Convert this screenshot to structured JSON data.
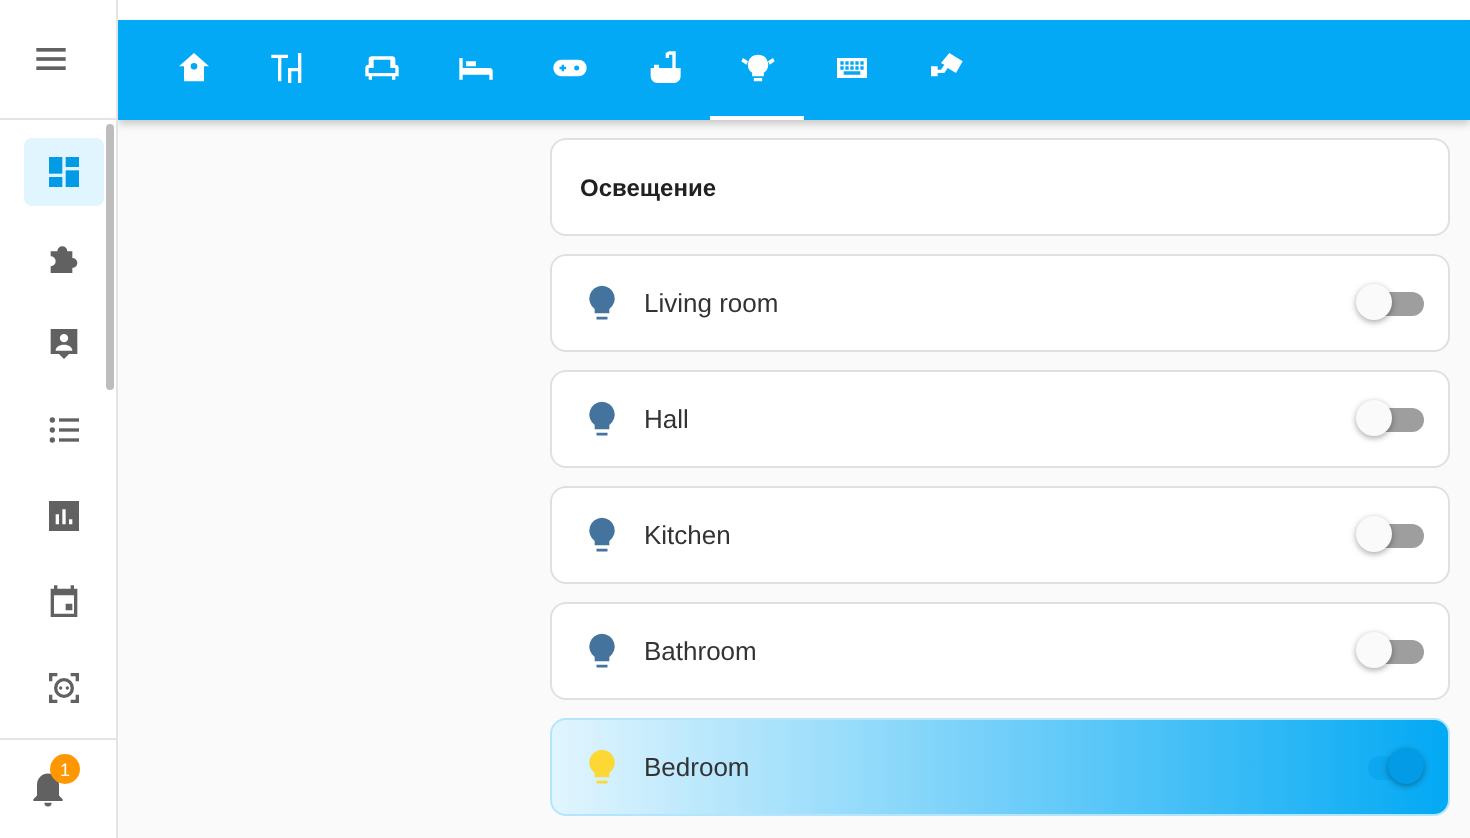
{
  "toolbar": {
    "tabs": [
      {
        "selected": false
      },
      {
        "selected": false
      },
      {
        "selected": false
      },
      {
        "selected": false
      },
      {
        "selected": false
      },
      {
        "selected": false
      },
      {
        "selected": true
      },
      {
        "selected": false
      },
      {
        "selected": false
      }
    ]
  },
  "sidebar": {
    "items": [
      {
        "selected": true
      },
      {
        "selected": false
      },
      {
        "selected": false
      },
      {
        "selected": false
      },
      {
        "selected": false
      },
      {
        "selected": false
      },
      {
        "selected": false
      }
    ],
    "notifications_badge": "1"
  },
  "card": {
    "title": "Освещение",
    "lights": [
      {
        "name": "Living room",
        "on": false
      },
      {
        "name": "Hall",
        "on": false
      },
      {
        "name": "Kitchen",
        "on": false
      },
      {
        "name": "Bathroom",
        "on": false
      },
      {
        "name": "Bedroom",
        "on": true
      }
    ]
  }
}
